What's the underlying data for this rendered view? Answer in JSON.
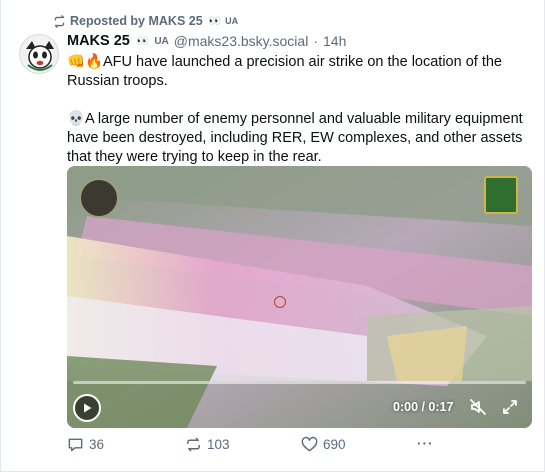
{
  "repost": {
    "label": "Reposted by MAKS 25",
    "flag": "UA",
    "icon": "repost-icon"
  },
  "author": {
    "name": "MAKS 25",
    "flag": "UA",
    "handle": "@maks23.bsky.social",
    "separator": "·",
    "time": "14h"
  },
  "post": {
    "paragraph1": "AFU have launched a precision air strike on the location of the Russian troops.",
    "paragraph2": "A large number of enemy personnel and valuable military equipment have been destroyed, including RER, EW complexes, and other assets that they were trying to keep in the rear."
  },
  "video": {
    "time": "0:00 / 0:17",
    "progress": 0,
    "colors": {
      "glare": "#f2b8d6",
      "haze": "#e6e6f2",
      "foliage": "#6f8a5a"
    }
  },
  "actions": {
    "replies": "36",
    "reposts": "103",
    "likes": "690",
    "more": "···"
  },
  "colors": {
    "muted": "#5c6b7a",
    "text": "#0b0f14",
    "border": "#e3e8ee"
  }
}
